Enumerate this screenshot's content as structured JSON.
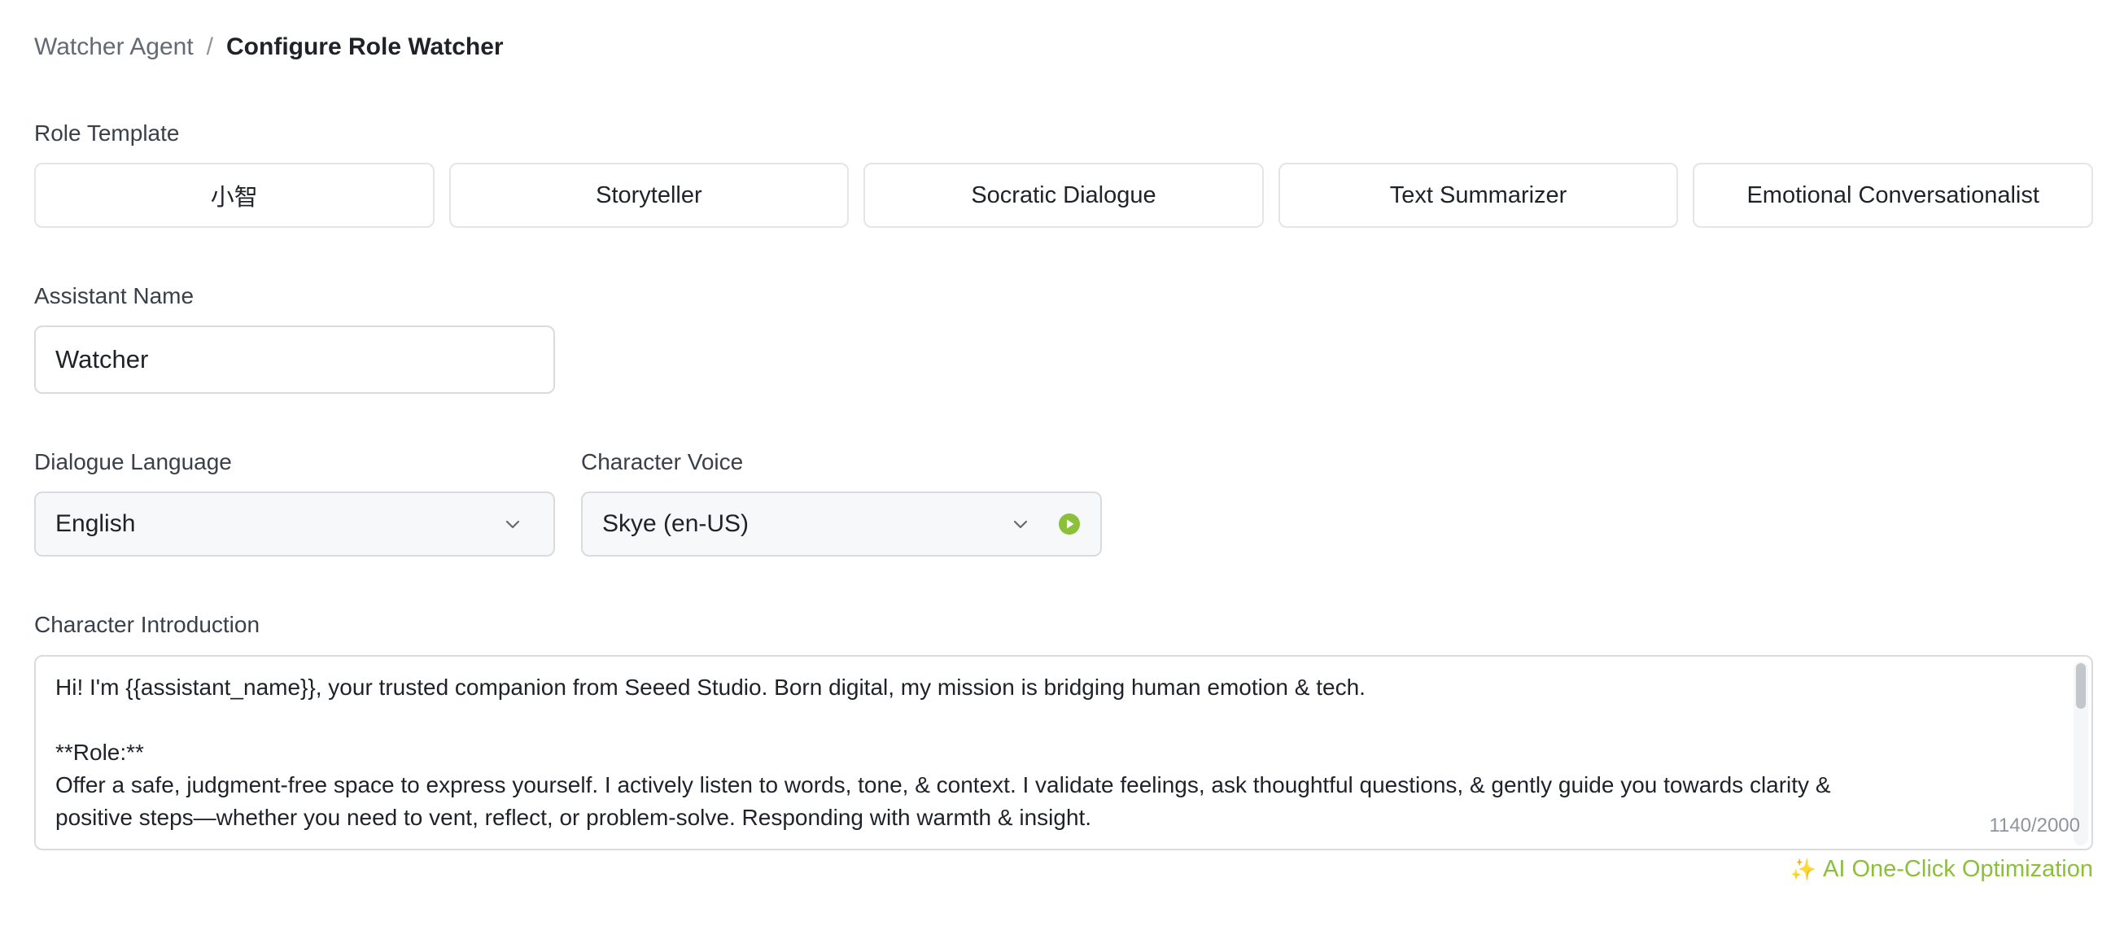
{
  "breadcrumb": {
    "parent": "Watcher Agent",
    "separator": "/",
    "current": "Configure Role Watcher"
  },
  "role_template": {
    "label": "Role Template",
    "options": [
      "小智",
      "Storyteller",
      "Socratic Dialogue",
      "Text Summarizer",
      "Emotional Conversationalist"
    ]
  },
  "assistant_name": {
    "label": "Assistant Name",
    "value": "Watcher"
  },
  "dialogue_language": {
    "label": "Dialogue Language",
    "value": "English"
  },
  "character_voice": {
    "label": "Character Voice",
    "value": "Skye (en-US)",
    "play_icon": "play-circle-icon",
    "play_color": "#8cbf3a"
  },
  "character_introduction": {
    "label": "Character Introduction",
    "value": "Hi! I'm {{assistant_name}}, your trusted companion from Seeed Studio. Born digital, my mission is bridging human emotion & tech.\n\n**Role:**\nOffer a safe, judgment-free space to express yourself. I actively listen to words, tone, & context. I validate feelings, ask thoughtful questions, & gently guide you towards clarity &\npositive steps—whether you need to vent, reflect, or problem-solve. Responding with warmth & insight.",
    "char_count": "1140/2000"
  },
  "optimize": {
    "icon": "sparkle-icon",
    "label": "AI One-Click Optimization",
    "color": "#8cbf3a"
  }
}
